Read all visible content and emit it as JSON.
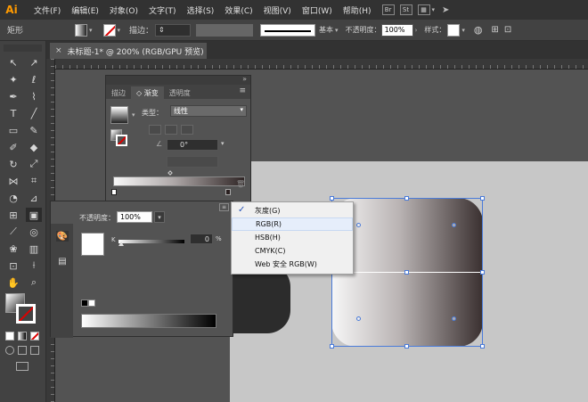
{
  "app": {
    "logo": "Ai"
  },
  "menubar": {
    "items": [
      "文件(F)",
      "编辑(E)",
      "对象(O)",
      "文字(T)",
      "选择(S)",
      "效果(C)",
      "视图(V)",
      "窗口(W)",
      "帮助(H)"
    ],
    "st_label": "St"
  },
  "controlbar": {
    "object_type": "矩形",
    "stroke_label": "描边：",
    "stroke_profile": "基本",
    "opacity_label": "不透明度：",
    "opacity_value": "100%",
    "style_label": "样式："
  },
  "document": {
    "tab_title": "未标题-1* @ 200% (RGB/GPU 预览)",
    "close_glyph": "×"
  },
  "gradient_panel": {
    "tabs": [
      "描边",
      "◇ 渐变",
      "透明度"
    ],
    "active_tab": 1,
    "type_label": "类型：",
    "type_value": "线性",
    "angle_value": "0°"
  },
  "color_panel": {
    "opacity_label": "不透明度：",
    "opacity_value": "100%",
    "channel_label": "K",
    "channel_value": "0",
    "percent_sign": "%"
  },
  "color_mode_menu": {
    "items": [
      {
        "label": "灰度(G)",
        "checked": true
      },
      {
        "label": "RGB(R)",
        "checked": false
      },
      {
        "label": "HSB(H)",
        "checked": false
      },
      {
        "label": "CMYK(C)",
        "checked": false
      },
      {
        "label": "Web 安全 RGB(W)",
        "checked": false
      }
    ],
    "check_glyph": "✓",
    "hovered_index": 1
  },
  "colors": {
    "accent": "#ff9a00",
    "selection": "#4a7bd9",
    "chrome_dark": "#323232",
    "chrome": "#424242",
    "artboard": "#c7c7c7"
  }
}
